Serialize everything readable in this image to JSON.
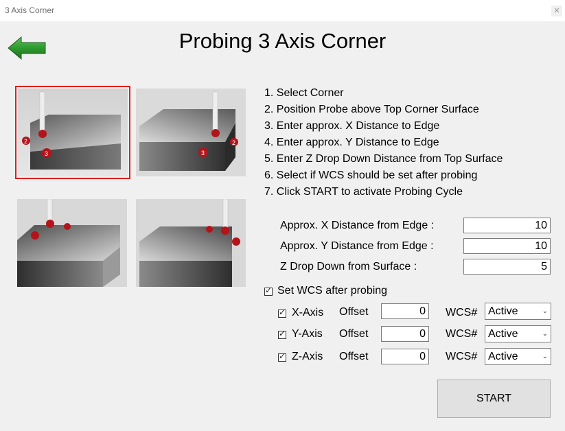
{
  "window": {
    "title": "3 Axis Corner"
  },
  "page": {
    "title": "Probing 3 Axis Corner"
  },
  "corners": [
    {
      "label": "corner-front-left",
      "selected": true
    },
    {
      "label": "corner-front-right",
      "selected": false
    },
    {
      "label": "corner-back-left",
      "selected": false
    },
    {
      "label": "corner-back-right",
      "selected": false
    }
  ],
  "steps": [
    "1. Select Corner",
    "2. Position Probe above Top Corner Surface",
    "3. Enter approx. X Distance to Edge",
    "4. Enter approx. Y Distance to Edge",
    "5. Enter Z Drop Down Distance from Top Surface",
    "6. Select if WCS should be set after probing",
    "7. Click START to activate Probing Cycle"
  ],
  "params": {
    "x_label": "Approx. X Distance from Edge :",
    "x_value": "10",
    "y_label": "Approx. Y Distance from Edge :",
    "y_value": "10",
    "z_label": "Z Drop Down from Surface :",
    "z_value": "5"
  },
  "wcs": {
    "set_label": "Set WCS after probing",
    "set_checked": true,
    "axes": [
      {
        "label": "X-Axis",
        "checked": true,
        "offset_label": "Offset",
        "offset": "0",
        "wcs_label": "WCS#",
        "wcs_value": "Active"
      },
      {
        "label": "Y-Axis",
        "checked": true,
        "offset_label": "Offset",
        "offset": "0",
        "wcs_label": "WCS#",
        "wcs_value": "Active"
      },
      {
        "label": "Z-Axis",
        "checked": true,
        "offset_label": "Offset",
        "offset": "0",
        "wcs_label": "WCS#",
        "wcs_value": "Active"
      }
    ]
  },
  "start": {
    "label": "START"
  },
  "colors": {
    "accent_green": "#2e8b2e",
    "selection_red": "#e01e1e",
    "probe_ball": "#b3141a"
  }
}
